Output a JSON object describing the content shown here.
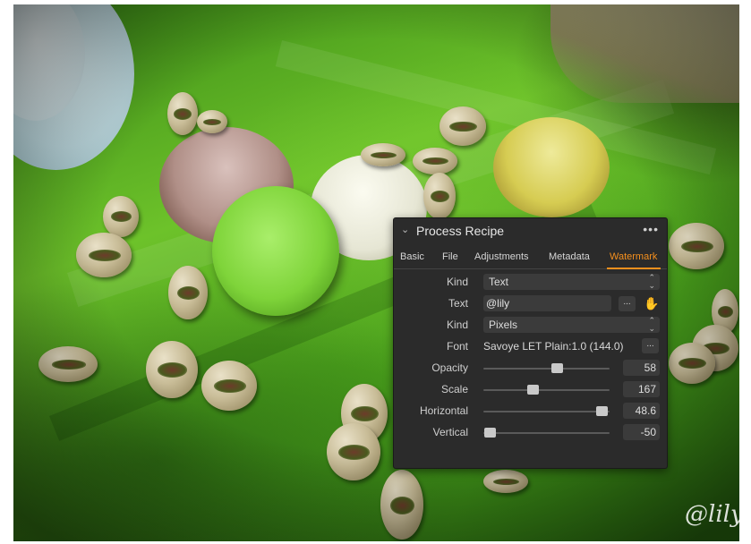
{
  "photo": {
    "watermark_text": "@lily"
  },
  "panel": {
    "title": "Process Recipe",
    "more_label": "•••",
    "tabs": [
      {
        "label": "Basic",
        "active": false
      },
      {
        "label": "File",
        "active": false
      },
      {
        "label": "Adjustments",
        "active": false
      },
      {
        "label": "Metadata",
        "active": false
      },
      {
        "label": "Watermark",
        "active": true
      }
    ],
    "accent_color": "#f5901e",
    "kind": {
      "label": "Kind",
      "value": "Text"
    },
    "text": {
      "label": "Text",
      "value": "@lily",
      "browse_label": "..."
    },
    "size_kind": {
      "label": "Kind",
      "value": "Pixels"
    },
    "font": {
      "label": "Font",
      "value": "Savoye LET Plain:1.0 (144.0)",
      "browse_label": "..."
    },
    "opacity": {
      "label": "Opacity",
      "value": "58",
      "fraction": 0.58
    },
    "scale": {
      "label": "Scale",
      "value": "167",
      "fraction": 0.39
    },
    "horizontal": {
      "label": "Horizontal",
      "value": "48.6",
      "fraction": 0.935
    },
    "vertical": {
      "label": "Vertical",
      "value": "-50",
      "fraction": 0.05
    }
  }
}
